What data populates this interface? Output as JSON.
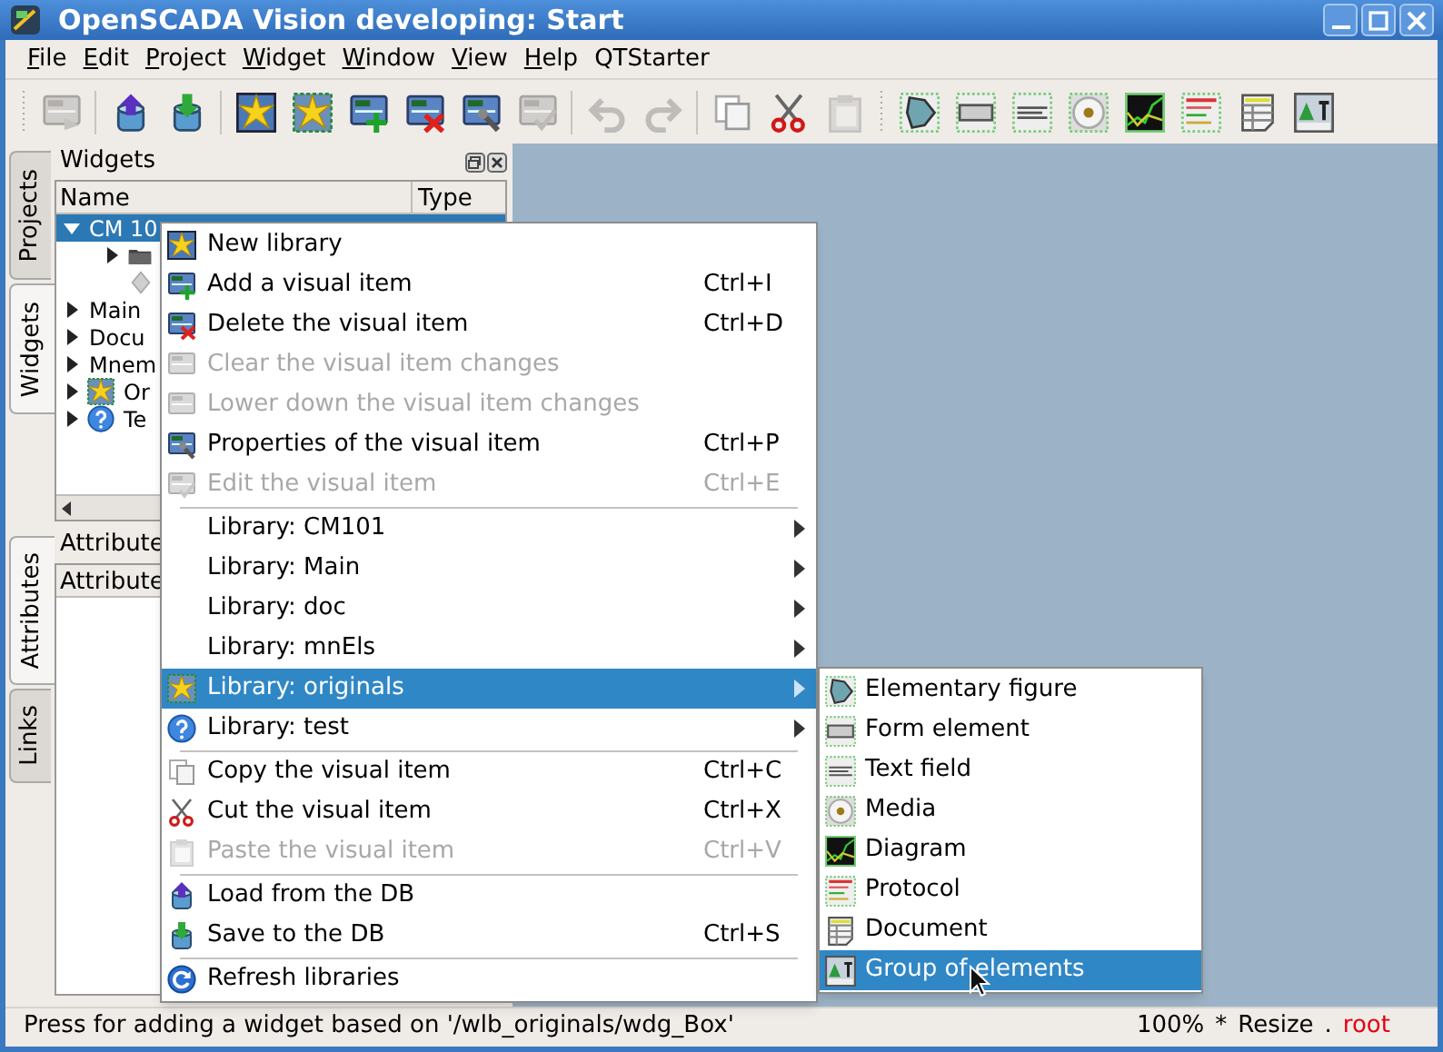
{
  "window": {
    "title": "OpenSCADA Vision developing: Start"
  },
  "menubar": [
    {
      "label": "File",
      "mnemonic": true
    },
    {
      "label": "Edit",
      "mnemonic": true
    },
    {
      "label": "Project",
      "mnemonic": true
    },
    {
      "label": "Widget",
      "mnemonic": true
    },
    {
      "label": "Window",
      "mnemonic": true
    },
    {
      "label": "View",
      "mnemonic": true
    },
    {
      "label": "Help",
      "mnemonic": true
    },
    {
      "label": "QTStarter",
      "mnemonic": false
    }
  ],
  "toolbar": [
    [
      {
        "disabled": true
      }
    ],
    [
      {
        "disabled": false
      },
      {
        "disabled": false
      }
    ],
    [
      {
        "disabled": false
      },
      {
        "disabled": false
      },
      {
        "disabled": false
      },
      {
        "disabled": false
      },
      {
        "disabled": false
      },
      {
        "disabled": true
      }
    ],
    [
      {
        "disabled": true
      },
      {
        "disabled": true
      }
    ],
    [
      {
        "disabled": false
      },
      {
        "disabled": false
      },
      {
        "disabled": true
      }
    ],
    [
      {
        "disabled": false
      },
      {
        "disabled": false
      },
      {
        "disabled": false
      },
      {
        "disabled": false
      },
      {
        "disabled": false
      },
      {
        "disabled": false
      },
      {
        "disabled": false
      },
      {
        "disabled": false
      }
    ]
  ],
  "side_tabs_top": [
    {
      "label": "Projects",
      "selected": false
    },
    {
      "label": "Widgets",
      "selected": true
    }
  ],
  "widgets_dock": {
    "title": "Widgets",
    "columns": [
      "Name",
      "Type"
    ],
    "tree": [
      {
        "kind": "library",
        "label": "CM 10",
        "expanded": true,
        "selected": true,
        "children": [
          {
            "kind": "folder",
            "expanded": false
          },
          {
            "kind": "widget"
          }
        ]
      },
      {
        "kind": "library",
        "label": "Main",
        "expanded": false,
        "selected": false
      },
      {
        "kind": "library",
        "label": "Docu",
        "expanded": false,
        "selected": false
      },
      {
        "kind": "library",
        "label": "Mnem",
        "expanded": false,
        "selected": false
      },
      {
        "kind": "starburst-library",
        "label": "Or",
        "expanded": false,
        "selected": false
      },
      {
        "kind": "help-library",
        "label": "Te",
        "expanded": false,
        "selected": false
      }
    ]
  },
  "side_tabs_bottom": [
    {
      "label": "Attributes",
      "selected": true
    },
    {
      "label": "Links",
      "selected": false
    }
  ],
  "attributes_dock": {
    "title": "Attribute",
    "columns": [
      "Attribute"
    ]
  },
  "context_menu": {
    "items": [
      {
        "kind": "action",
        "label": "New library",
        "selected": false,
        "disabled": false
      },
      {
        "kind": "action",
        "label": "Add a visual item",
        "shortcut": "Ctrl+I",
        "selected": false,
        "disabled": false
      },
      {
        "kind": "action",
        "label": "Delete the visual item",
        "shortcut": "Ctrl+D",
        "selected": false,
        "disabled": false
      },
      {
        "kind": "action",
        "label": "Clear the visual item changes",
        "selected": false,
        "disabled": true
      },
      {
        "kind": "action",
        "label": "Lower down the visual item changes",
        "selected": false,
        "disabled": true
      },
      {
        "kind": "action",
        "label": "Properties of the visual item",
        "shortcut": "Ctrl+P",
        "selected": false,
        "disabled": false
      },
      {
        "kind": "action",
        "label": "Edit the visual item",
        "shortcut": "Ctrl+E",
        "selected": false,
        "disabled": true
      },
      {
        "kind": "separator"
      },
      {
        "kind": "submenu",
        "label": "Library: CM101",
        "selected": false,
        "disabled": false
      },
      {
        "kind": "submenu",
        "label": "Library: Main",
        "selected": false,
        "disabled": false
      },
      {
        "kind": "submenu",
        "label": "Library: doc",
        "selected": false,
        "disabled": false
      },
      {
        "kind": "submenu",
        "label": "Library: mnEls",
        "selected": false,
        "disabled": false
      },
      {
        "kind": "submenu",
        "label": "Library: originals",
        "selected": true,
        "disabled": false
      },
      {
        "kind": "submenu",
        "label": "Library: test",
        "selected": false,
        "disabled": false
      },
      {
        "kind": "separator"
      },
      {
        "kind": "action",
        "label": "Copy the visual item",
        "shortcut": "Ctrl+C",
        "selected": false,
        "disabled": false
      },
      {
        "kind": "action",
        "label": "Cut the visual item",
        "shortcut": "Ctrl+X",
        "selected": false,
        "disabled": false
      },
      {
        "kind": "action",
        "label": "Paste the visual item",
        "shortcut": "Ctrl+V",
        "selected": false,
        "disabled": true
      },
      {
        "kind": "separator"
      },
      {
        "kind": "action",
        "label": "Load from the DB",
        "selected": false,
        "disabled": false
      },
      {
        "kind": "action",
        "label": "Save to the DB",
        "shortcut": "Ctrl+S",
        "selected": false,
        "disabled": false
      },
      {
        "kind": "separator"
      },
      {
        "kind": "action",
        "label": "Refresh libraries",
        "selected": false,
        "disabled": false
      }
    ]
  },
  "submenu": {
    "items": [
      {
        "label": "Elementary figure",
        "selected": false
      },
      {
        "label": "Form element",
        "selected": false
      },
      {
        "label": "Text field",
        "selected": false
      },
      {
        "label": "Media",
        "selected": false
      },
      {
        "label": "Diagram",
        "selected": false
      },
      {
        "label": "Protocol",
        "selected": false
      },
      {
        "label": "Document",
        "selected": false
      },
      {
        "label": "Group of elements",
        "selected": true
      }
    ]
  },
  "status_bar": {
    "message": "Press for adding a widget based on '/wlb_originals/wdg_Box'",
    "zoom": "100%",
    "modified": "*",
    "mode": "Resize",
    "separator": ".",
    "user": "root"
  }
}
